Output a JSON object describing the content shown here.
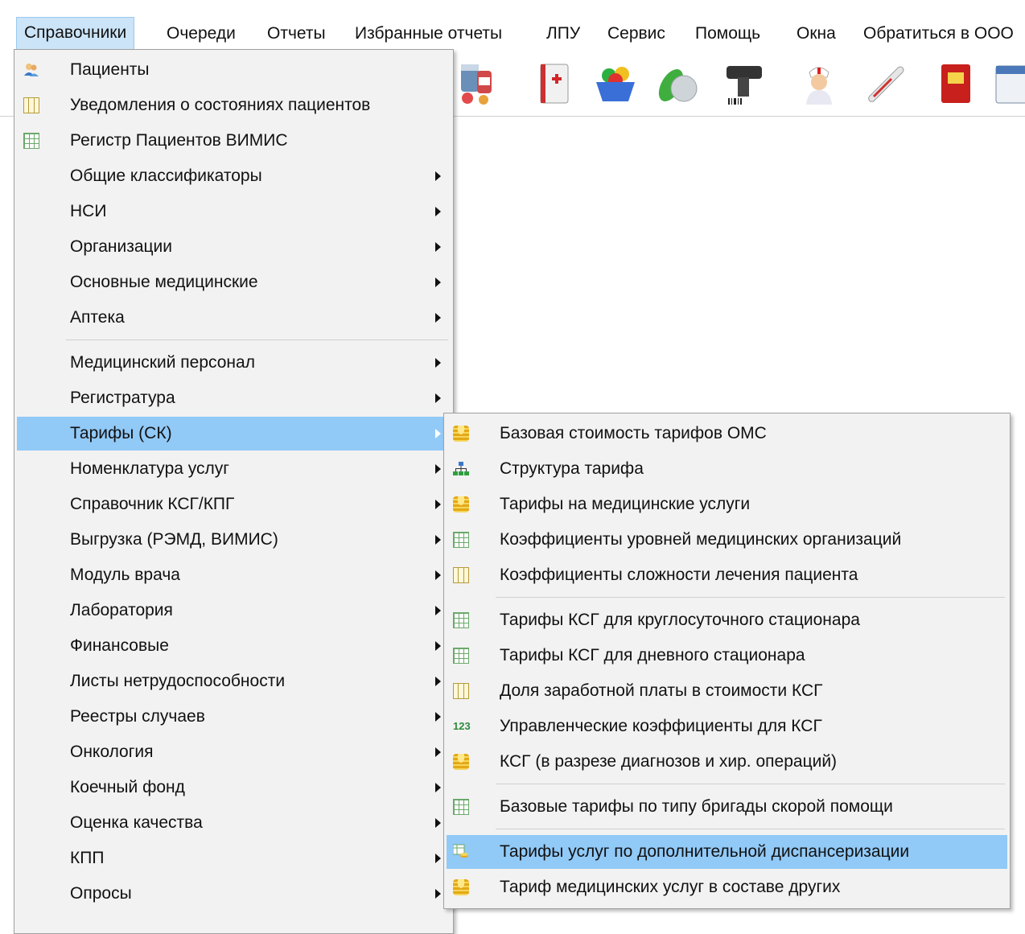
{
  "menubar": {
    "items": [
      "Справочники",
      "Очереди",
      "Отчеты",
      "Избранные отчеты",
      "ЛПУ",
      "Сервис",
      "Помощь",
      "Окна",
      "Обратиться в ООО"
    ]
  },
  "toolbar": {
    "icons": [
      "pills-icon",
      "medical-book-icon",
      "basket-icon",
      "capsules-icon",
      "barcode-scanner-icon",
      "nurse-icon",
      "thermometer-icon",
      "red-book-icon",
      "calendar-icon"
    ]
  },
  "main_menu": {
    "items": [
      {
        "label": "Пациенты",
        "icon": "patients-icon",
        "submenu": false
      },
      {
        "label": "Уведомления о состояниях пациентов",
        "icon": "columns-icon",
        "submenu": false
      },
      {
        "label": "Регистр Пациентов ВИМИС",
        "icon": "grid-icon",
        "submenu": false
      },
      {
        "label": "Общие классификаторы",
        "icon": "",
        "submenu": true
      },
      {
        "label": "НСИ",
        "icon": "",
        "submenu": true
      },
      {
        "label": "Организации",
        "icon": "",
        "submenu": true
      },
      {
        "label": "Основные медицинские",
        "icon": "",
        "submenu": true
      },
      {
        "label": "Аптека",
        "icon": "",
        "submenu": true
      },
      {
        "label": "Медицинский персонал",
        "icon": "",
        "submenu": true
      },
      {
        "label": "Регистратура",
        "icon": "",
        "submenu": true
      },
      {
        "label": "Тарифы (СК)",
        "icon": "",
        "submenu": true,
        "selected": true
      },
      {
        "label": "Номенклатура услуг",
        "icon": "",
        "submenu": true
      },
      {
        "label": "Справочник КСГ/КПГ",
        "icon": "",
        "submenu": true
      },
      {
        "label": "Выгрузка (РЭМД, ВИМИС)",
        "icon": "",
        "submenu": true
      },
      {
        "label": "Модуль врача",
        "icon": "",
        "submenu": true
      },
      {
        "label": "Лаборатория",
        "icon": "",
        "submenu": true
      },
      {
        "label": "Финансовые",
        "icon": "",
        "submenu": true
      },
      {
        "label": "Листы нетрудоспособности",
        "icon": "",
        "submenu": true
      },
      {
        "label": "Реестры случаев",
        "icon": "",
        "submenu": true
      },
      {
        "label": "Онкология",
        "icon": "",
        "submenu": true
      },
      {
        "label": "Коечный фонд",
        "icon": "",
        "submenu": true
      },
      {
        "label": "Оценка качества",
        "icon": "",
        "submenu": true
      },
      {
        "label": "КПП",
        "icon": "",
        "submenu": true
      },
      {
        "label": "Опросы",
        "icon": "",
        "submenu": true
      }
    ]
  },
  "sub_menu": {
    "items": [
      {
        "label": "Базовая стоимость тарифов ОМС",
        "icon": "coins-icon"
      },
      {
        "label": "Структура тарифа",
        "icon": "hierarchy-icon"
      },
      {
        "label": "Тарифы на медицинские услуги",
        "icon": "coins-icon"
      },
      {
        "label": "Коэффициенты уровней медицинских организаций",
        "icon": "grid-icon"
      },
      {
        "label": "Коэффициенты сложности лечения пациента",
        "icon": "columns-icon"
      },
      {
        "label": "Тарифы КСГ для круглосуточного стационара",
        "icon": "grid-icon"
      },
      {
        "label": "Тарифы КСГ для дневного стационара",
        "icon": "grid-icon"
      },
      {
        "label": "Доля заработной платы в стоимости КСГ",
        "icon": "columns-icon"
      },
      {
        "label": "Управленческие коэффициенты для КСГ",
        "icon": "numbers-icon"
      },
      {
        "label": "КСГ (в разрезе диагнозов и хир. операций)",
        "icon": "coins-icon"
      },
      {
        "label": "Базовые тарифы по типу бригады скорой помощи",
        "icon": "grid-icon"
      },
      {
        "label": "Тарифы услуг по дополнительной диспансеризации",
        "icon": "table-coins-icon",
        "selected": true
      },
      {
        "label": "Тариф медицинских услуг в составе других",
        "icon": "coins-icon"
      }
    ],
    "numbers_icon_text": "123"
  },
  "colors": {
    "highlight": "#91c9f7",
    "menu_bg": "#f2f2f2",
    "active_top": "#cce4f7"
  }
}
